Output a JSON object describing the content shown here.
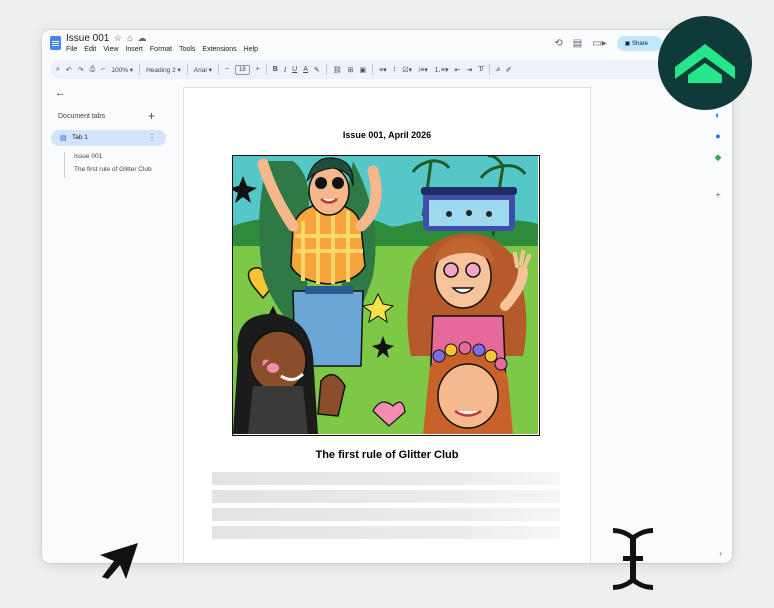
{
  "header": {
    "doc_title": "Issue 001",
    "menu": [
      "File",
      "Edit",
      "View",
      "Insert",
      "Format",
      "Tools",
      "Extensions",
      "Help"
    ],
    "share_label": "Share"
  },
  "toolbar": {
    "zoom": "100%",
    "style": "Heading 2",
    "font": "Arial",
    "font_size": "18",
    "bold": "B",
    "italic": "I",
    "underline": "U",
    "text_color": "A"
  },
  "sidebar": {
    "title": "Document tabs",
    "tab_label": "Tab 1",
    "outline": [
      "Issue 001",
      "The first rule of Glitter Club"
    ]
  },
  "document": {
    "issue_date": "Issue 001, April 2026",
    "headline": "The first rule of Glitter Club"
  },
  "colors": {
    "accent": "#0b57d0",
    "share_bg": "#c2e7ff",
    "logo_bg": "#0e3b3a",
    "logo_mark": "#27e68a"
  },
  "icons": {
    "docs": "docs-icon",
    "star": "star-icon",
    "history": "history-icon",
    "comments": "comment-icon",
    "meet": "video-icon",
    "back": "arrow-left-icon",
    "logo": "double-chevron-logo",
    "cursor": "pointer-cursor",
    "text_cursor": "ibeam-cursor"
  }
}
